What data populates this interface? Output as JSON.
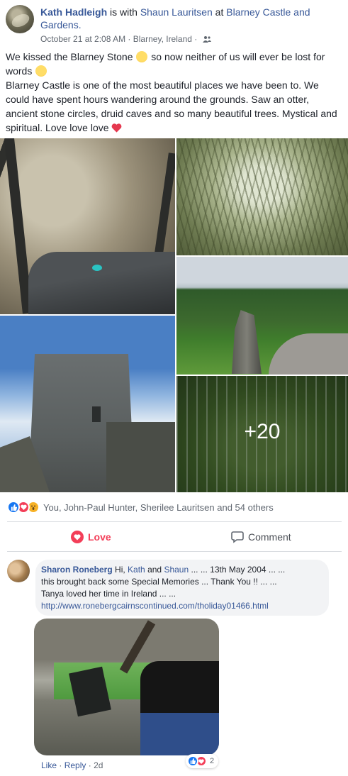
{
  "post": {
    "author": "Kath Hadleigh",
    "is_with": "is with",
    "with_person": "Shaun Lauritsen",
    "at": "at",
    "place": "Blarney Castle and Gardens.",
    "timestamp": "October 21 at 2:08 AM",
    "separator": "·",
    "location": "Blarney, Ireland",
    "separator2": "·",
    "privacy_icon": "friends-icon",
    "text_line1a": "We kissed the Blarney Stone",
    "text_line1b": "so now neither of us will ever be lost for",
    "text_line1c": "words",
    "text_para2": "Blarney Castle is one of the most beautiful places we have been to. We could have spent hours wandering around the grounds. Saw an otter, ancient stone circles, druid caves and so many beautiful trees. Mystical and spiritual. Love love love",
    "more_photos": "+20"
  },
  "reactions": {
    "icons": [
      "like-icon",
      "love-icon",
      "wow-icon"
    ],
    "summary": "You, John-Paul Hunter, Sherilee Lauritsen and 54 others"
  },
  "actions": {
    "love_label": "Love",
    "comment_label": "Comment"
  },
  "comment": {
    "author": "Sharon Roneberg",
    "text_a": "Hi,",
    "mention1": "Kath",
    "and": "and",
    "mention2": "Shaun",
    "text_b": "... ... 13th May 2004 ... ...",
    "text_c": "this brought back some Special Memories ... Thank You !! ... ...",
    "text_d": "Tanya loved her time in Ireland ... ...",
    "link": "http://www.ronebergcairnscontinued.com/tholiday01466.html",
    "like_label": "Like",
    "sep1": "·",
    "reply_label": "Reply",
    "sep2": "·",
    "age": "2d",
    "reaction_count": "2"
  },
  "colors": {
    "link": "#385898",
    "love": "#f33e58",
    "like": "#1877f2",
    "wow": "#f7b125",
    "muted": "#606770"
  }
}
